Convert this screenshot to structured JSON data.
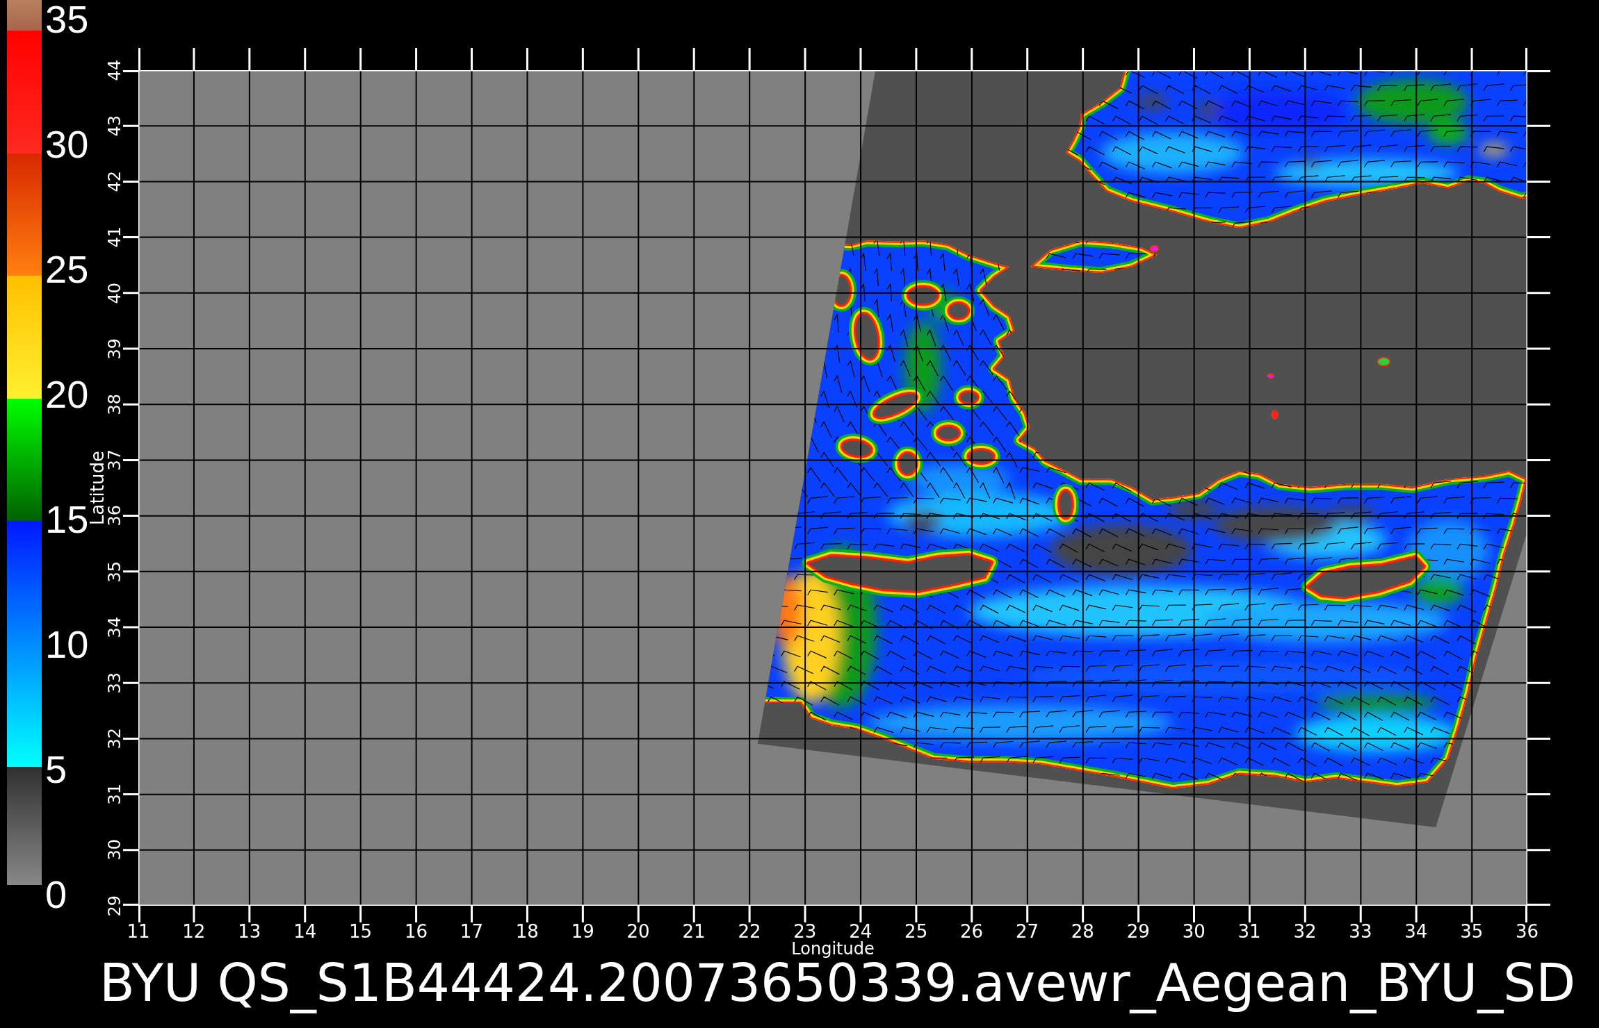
{
  "color_scale": {
    "labels": [
      "35",
      "30",
      "25",
      "20",
      "15",
      "10",
      "5",
      "0"
    ]
  },
  "plot": {
    "ylabel": "Latitude",
    "latitude_ticks": [
      "44",
      "43",
      "42",
      "41",
      "40",
      "39",
      "38",
      "37",
      "36",
      "35",
      "34",
      "33",
      "32",
      "31",
      "30",
      "29"
    ],
    "longitude_ticks": [
      "11",
      "12",
      "13",
      "14",
      "15",
      "16",
      "17",
      "18",
      "19",
      "20",
      "21",
      "22",
      "23",
      "24",
      "25",
      "26",
      "27",
      "28",
      "29",
      "30",
      "31",
      "32",
      "33",
      "34",
      "35",
      "36"
    ],
    "xlabel": "Longitude"
  },
  "title": "BYU QS_S1B44424.20073650339.avewr_Aegean_BYU_SD"
}
